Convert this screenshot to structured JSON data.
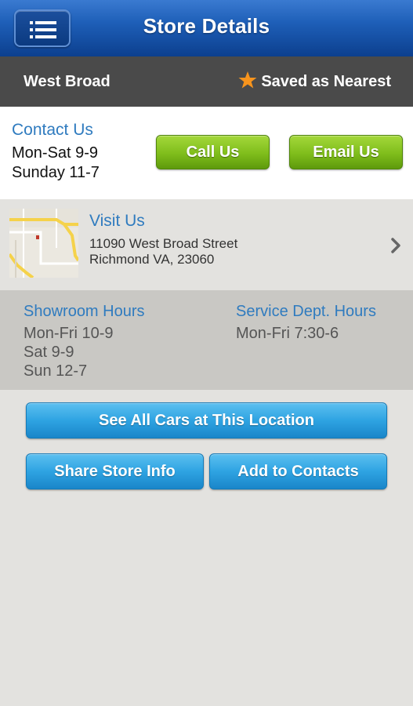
{
  "header": {
    "title": "Store Details",
    "menu_icon": "hamburger-menu-icon"
  },
  "store_bar": {
    "store_name": "West Broad",
    "nearest_label": "Saved as Nearest",
    "star_color": "#f7941d"
  },
  "contact": {
    "title": "Contact Us",
    "hours_line1": "Mon-Sat 9-9",
    "hours_line2": "Sunday 11-7",
    "call_label": "Call Us",
    "email_label": "Email Us"
  },
  "visit": {
    "title": "Visit Us",
    "address_line1": "11090 West Broad Street",
    "address_line2": "Richmond VA, 23060"
  },
  "hours": {
    "showroom_title": "Showroom Hours",
    "showroom_lines": [
      "Mon-Fri 10-9",
      "Sat 9-9",
      "Sun 12-7"
    ],
    "service_title": "Service Dept. Hours",
    "service_lines": [
      "Mon-Fri 7:30-6"
    ]
  },
  "actions": {
    "see_all_label": "See All Cars at This Location",
    "share_label": "Share Store Info",
    "add_contacts_label": "Add to Contacts"
  },
  "colors": {
    "accent_blue": "#2f7bbf",
    "green_button": "#7fbd1b",
    "blue_button": "#2ea3e2",
    "header_blue": "#1e5fb8"
  }
}
